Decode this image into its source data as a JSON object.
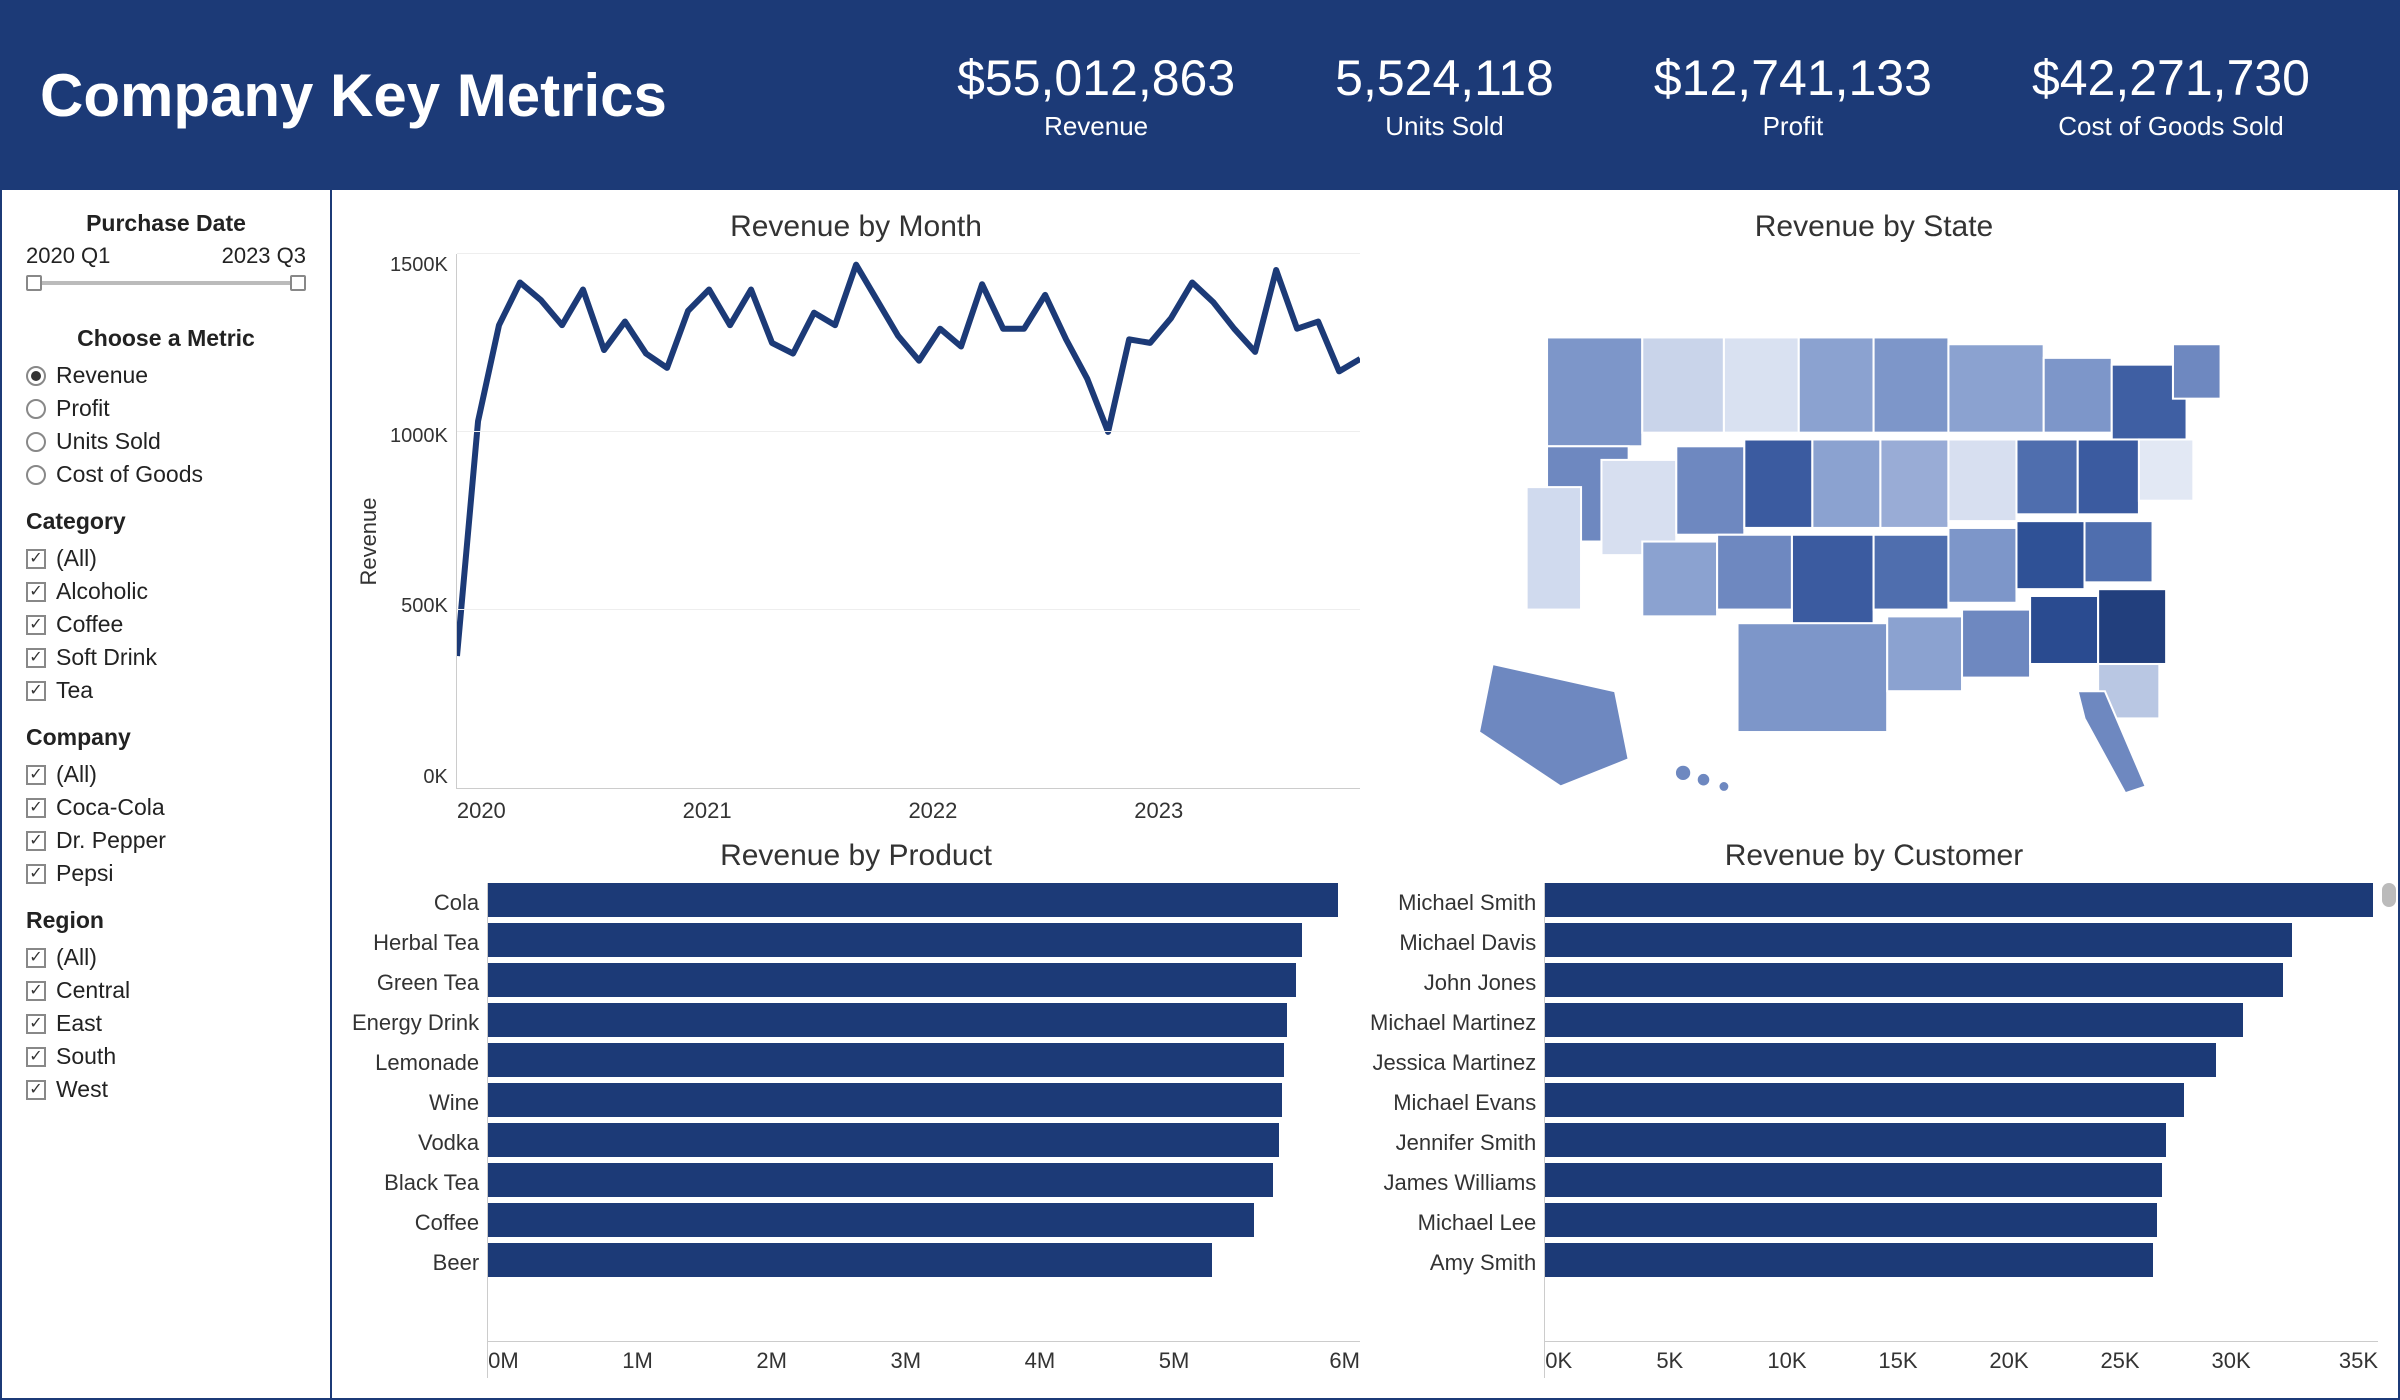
{
  "header": {
    "title": "Company Key Metrics",
    "metrics": [
      {
        "value": "$55,012,863",
        "label": "Revenue"
      },
      {
        "value": "5,524,118",
        "label": "Units Sold"
      },
      {
        "value": "$12,741,133",
        "label": "Profit"
      },
      {
        "value": "$42,271,730",
        "label": "Cost of Goods Sold"
      }
    ]
  },
  "sidebar": {
    "date_filter": {
      "title": "Purchase Date",
      "from": "2020 Q1",
      "to": "2023 Q3"
    },
    "metric_picker": {
      "title": "Choose a Metric",
      "options": [
        "Revenue",
        "Profit",
        "Units Sold",
        "Cost of Goods"
      ],
      "selected": "Revenue"
    },
    "category": {
      "title": "Category",
      "options": [
        "(All)",
        "Alcoholic",
        "Coffee",
        "Soft Drink",
        "Tea"
      ]
    },
    "company": {
      "title": "Company",
      "options": [
        "(All)",
        "Coca-Cola",
        "Dr. Pepper",
        "Pepsi"
      ]
    },
    "region": {
      "title": "Region",
      "options": [
        "(All)",
        "Central",
        "East",
        "South",
        "West"
      ]
    }
  },
  "panels": {
    "line": {
      "title": "Revenue by Month",
      "ylabel": "Revenue"
    },
    "map": {
      "title": "Revenue by State"
    },
    "product": {
      "title": "Revenue by Product"
    },
    "customer": {
      "title": "Revenue by Customer"
    }
  },
  "chart_data": [
    {
      "type": "line",
      "title": "Revenue by Month",
      "xlabel": "",
      "ylabel": "Revenue",
      "x_ticks": [
        "2020",
        "2021",
        "2022",
        "2023"
      ],
      "y_ticks": [
        "1500K",
        "1000K",
        "500K",
        "0K"
      ],
      "ylim": [
        0,
        1500000
      ],
      "values_k": [
        370,
        1030,
        1300,
        1420,
        1370,
        1300,
        1400,
        1230,
        1310,
        1220,
        1180,
        1340,
        1400,
        1300,
        1400,
        1250,
        1220,
        1335,
        1300,
        1470,
        1370,
        1270,
        1200,
        1290,
        1240,
        1415,
        1290,
        1290,
        1385,
        1260,
        1150,
        1000,
        1260,
        1250,
        1320,
        1420,
        1365,
        1290,
        1225,
        1455,
        1290,
        1310,
        1170,
        1205
      ]
    },
    {
      "type": "map",
      "title": "Revenue by State",
      "note": "US choropleth; darker blue = higher revenue; values not labeled"
    },
    {
      "type": "bar",
      "orientation": "horizontal",
      "title": "Revenue by Product",
      "xlabel": "",
      "xlim": [
        0,
        6000000
      ],
      "x_ticks": [
        "0M",
        "1M",
        "2M",
        "3M",
        "4M",
        "5M",
        "6M"
      ],
      "categories": [
        "Cola",
        "Herbal Tea",
        "Green Tea",
        "Energy Drink",
        "Lemonade",
        "Wine",
        "Vodka",
        "Black Tea",
        "Coffee",
        "Beer"
      ],
      "values": [
        5850000,
        5600000,
        5560000,
        5500000,
        5480000,
        5460000,
        5440000,
        5400000,
        5270000,
        4980000
      ]
    },
    {
      "type": "bar",
      "orientation": "horizontal",
      "title": "Revenue by Customer",
      "xlabel": "",
      "xlim": [
        0,
        37000
      ],
      "x_ticks": [
        "0K",
        "5K",
        "10K",
        "15K",
        "20K",
        "25K",
        "30K",
        "35K"
      ],
      "categories": [
        "Michael Smith",
        "Michael Davis",
        "John Jones",
        "Michael Martinez",
        "Jessica Martinez",
        "Michael Evans",
        "Jennifer Smith",
        "James Williams",
        "Michael Lee",
        "Amy Smith"
      ],
      "values": [
        36800,
        33200,
        32800,
        31000,
        29800,
        28400,
        27600,
        27400,
        27200,
        27000
      ]
    }
  ]
}
